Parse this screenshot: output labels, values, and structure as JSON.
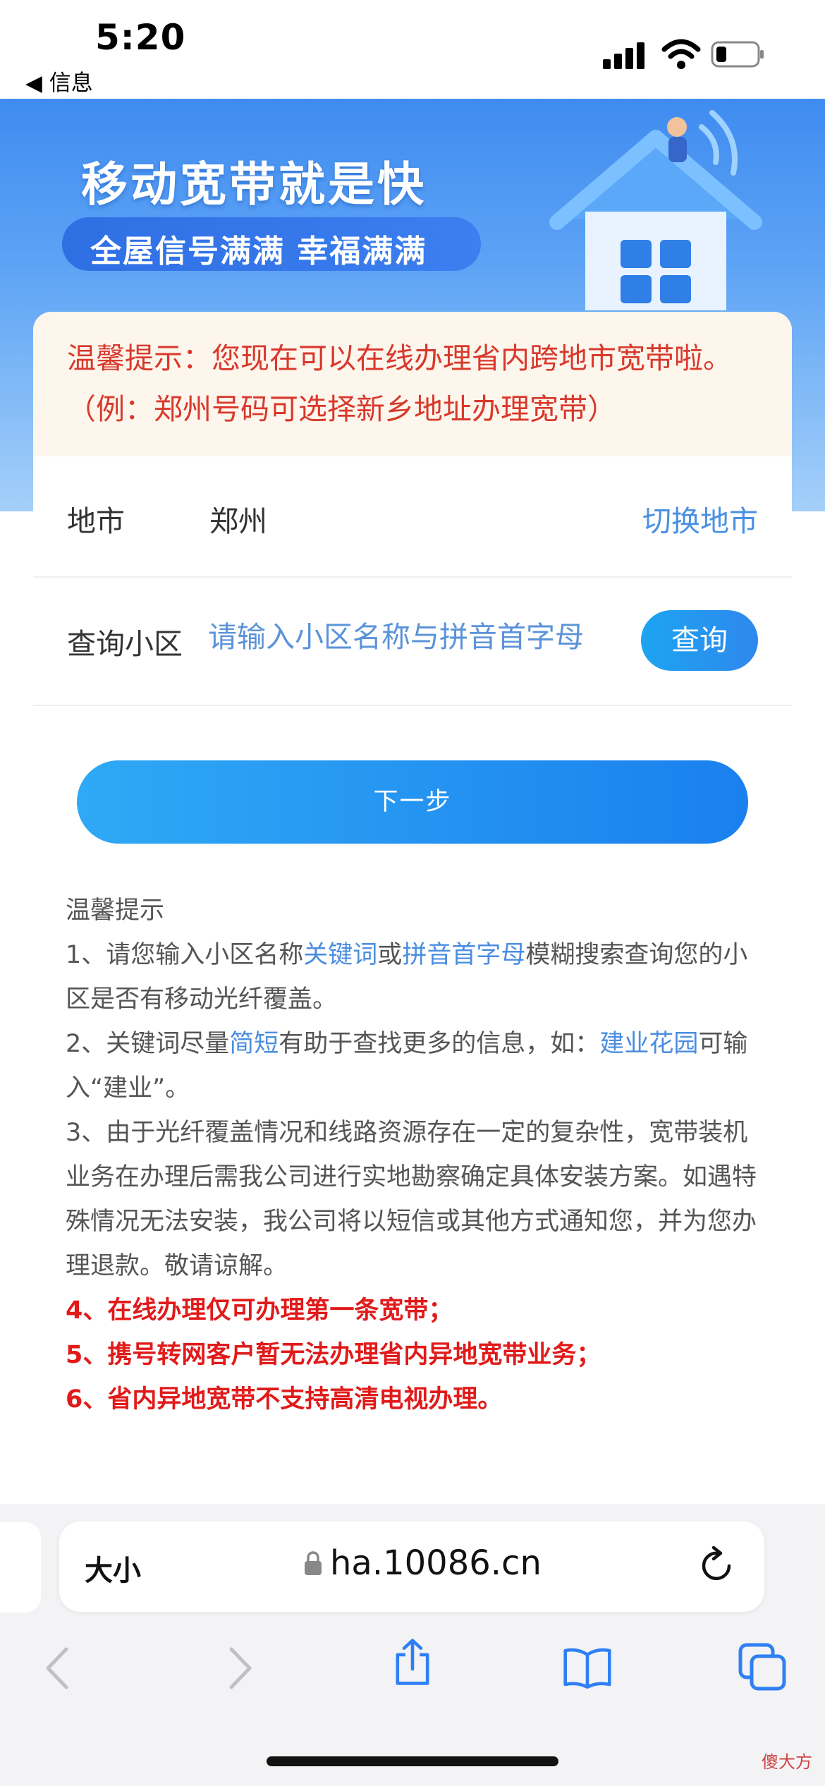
{
  "status_bar": {
    "time": "5:20",
    "back_label": "◀ 信息"
  },
  "banner": {
    "title": "移动宽带就是快",
    "subtitle": "全屋信号满满  幸福满满"
  },
  "notice": {
    "text": "温馨提示：您现在可以在线办理省内跨地市宽带啦。（例：郑州号码可选择新乡地址办理宽带）"
  },
  "city_row": {
    "label": "地市",
    "value": "郑州",
    "switch_label": "切换地市"
  },
  "query_row": {
    "label": "查询小区",
    "placeholder": "请输入小区名称与拼音首字母",
    "button_label": "查询"
  },
  "next_button": {
    "label": "下一步"
  },
  "tips": {
    "title": "温馨提示",
    "line1_a": "1、请您输入小区名称",
    "line1_hl1": "关键词",
    "line1_b": "或",
    "line1_hl2": "拼音首字母",
    "line1_c": "模糊搜索查询您的小区是否有移动光纤覆盖。",
    "line2_a": "2、关键词尽量",
    "line2_hl1": "简短",
    "line2_b": "有助于查找更多的信息，如：",
    "line2_hl2": "建业花园",
    "line2_c": "可输入“建业”。",
    "line3": "3、由于光纤覆盖情况和线路资源存在一定的复杂性，宽带装机业务在办理后需我公司进行实地勘察确定具体安装方案。如遇特殊情况无法安装，我公司将以短信或其他方式通知您，并为您办理退款。敬请谅解。",
    "line4": "4、在线办理仅可办理第一条宽带；",
    "line5": "5、携号转网客户暂无法办理省内异地宽带业务；",
    "line6": "6、省内异地宽带不支持高清电视办理。"
  },
  "browser": {
    "text_size_label": "大小",
    "url": "ha.10086.cn"
  },
  "watermark": "傻大方",
  "colors": {
    "accent": "#4a90e2",
    "notice_red": "#d9382c",
    "warning_red": "#e11a1a",
    "button_blue": "#1a80ee"
  }
}
